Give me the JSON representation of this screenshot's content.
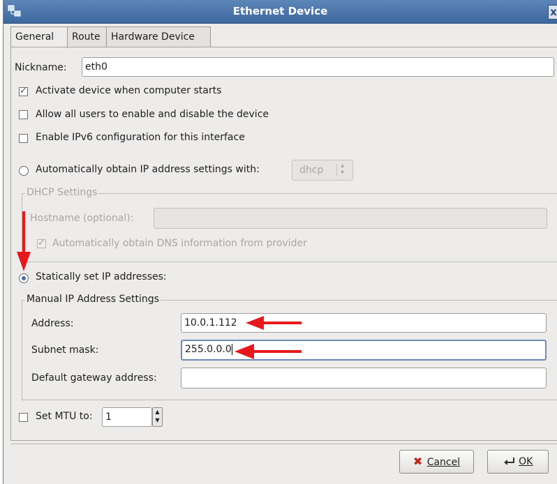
{
  "window": {
    "title": "Ethernet Device",
    "close_glyph": "x"
  },
  "tabs": [
    {
      "label": "General",
      "active": true
    },
    {
      "label": "Route",
      "active": false
    },
    {
      "label": "Hardware Device",
      "active": false
    }
  ],
  "nickname": {
    "label": "Nickname:",
    "value": "eth0"
  },
  "options": {
    "activate_on_start": {
      "label": "Activate device when computer starts",
      "checked": true
    },
    "allow_all_users": {
      "label": "Allow all users to enable and disable the device",
      "checked": false
    },
    "enable_ipv6": {
      "label": "Enable IPv6 configuration for this interface",
      "checked": false
    }
  },
  "auto_ip": {
    "label": "Automatically obtain IP address settings with:",
    "selected": false,
    "method_value": "dhcp"
  },
  "dhcp": {
    "frame_label": "DHCP Settings",
    "hostname_label": "Hostname (optional):",
    "hostname_value": "",
    "auto_dns_label": "Automatically obtain DNS information from provider",
    "auto_dns_checked": true
  },
  "static_ip": {
    "label": "Statically set IP addresses:",
    "selected": true
  },
  "manual": {
    "frame_label": "Manual IP Address Settings",
    "address_label": "Address:",
    "address_value": "10.0.1.112",
    "subnet_label": "Subnet mask:",
    "subnet_value": "255.0.0.0",
    "gateway_label": "Default gateway address:",
    "gateway_value": ""
  },
  "mtu": {
    "label": "Set MTU to:",
    "checked": false,
    "value": "1"
  },
  "buttons": {
    "cancel": "Cancel",
    "ok": "OK"
  },
  "colors": {
    "annotation_arrow": "#e8191c",
    "title_bar": "#4a76ab"
  }
}
